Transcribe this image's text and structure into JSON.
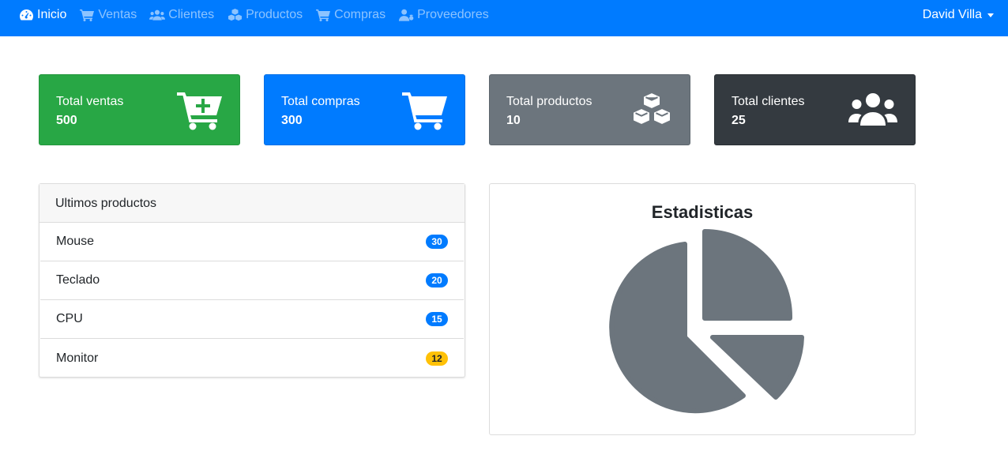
{
  "nav": {
    "items": [
      {
        "label": "Inicio",
        "icon": "tachometer-icon",
        "active": true
      },
      {
        "label": "Ventas",
        "icon": "cart-icon",
        "active": false
      },
      {
        "label": "Clientes",
        "icon": "users-icon",
        "active": false
      },
      {
        "label": "Productos",
        "icon": "cubes-icon",
        "active": false
      },
      {
        "label": "Compras",
        "icon": "cart-icon",
        "active": false
      },
      {
        "label": "Proveedores",
        "icon": "user-tie-icon",
        "active": false
      }
    ],
    "user": "David Villa"
  },
  "cards": [
    {
      "label": "Total ventas",
      "value": "500",
      "icon": "cart-plus-icon",
      "color": "#28a745"
    },
    {
      "label": "Total compras",
      "value": "300",
      "icon": "cart-icon",
      "color": "#007bff"
    },
    {
      "label": "Total productos",
      "value": "10",
      "icon": "cubes-icon",
      "color": "#6c757d"
    },
    {
      "label": "Total clientes",
      "value": "25",
      "icon": "users-icon",
      "color": "#343a40"
    }
  ],
  "products_panel": {
    "title": "Ultimos productos",
    "items": [
      {
        "name": "Mouse",
        "count": "30",
        "badge": "primary"
      },
      {
        "name": "Teclado",
        "count": "20",
        "badge": "primary"
      },
      {
        "name": "CPU",
        "count": "15",
        "badge": "primary"
      },
      {
        "name": "Monitor",
        "count": "12",
        "badge": "warning"
      }
    ]
  },
  "stats_panel": {
    "title": "Estadisticas",
    "icon": "pie-chart-icon",
    "color": "#6c757d"
  },
  "colors": {
    "primary": "#007bff",
    "success": "#28a745",
    "secondary": "#6c757d",
    "dark": "#343a40",
    "warning": "#ffc107"
  }
}
